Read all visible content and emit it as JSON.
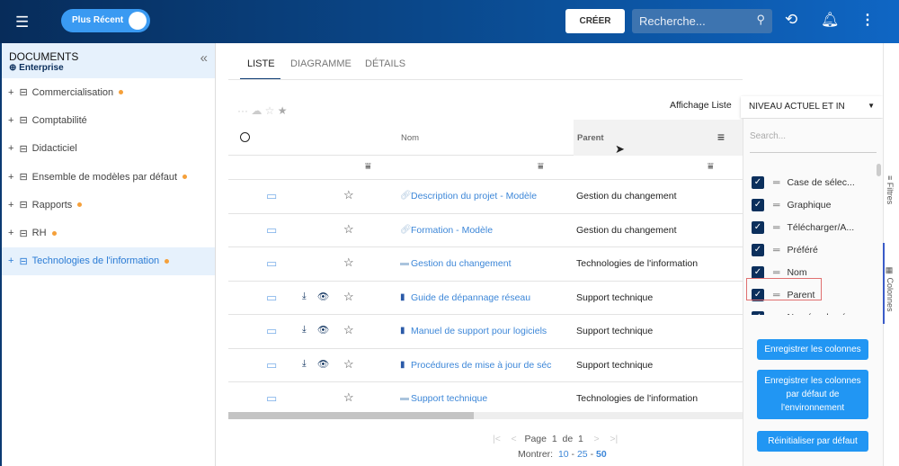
{
  "header": {
    "toggle_label": "Plus Récent",
    "create_label": "CRÉER",
    "search_placeholder": "Recherche..."
  },
  "sidebar": {
    "title": "DOCUMENTS",
    "subtitle": "Enterprise",
    "items": [
      {
        "label": "Commercialisation",
        "dot": true
      },
      {
        "label": "Comptabilité",
        "dot": false
      },
      {
        "label": "Didacticiel",
        "dot": false
      },
      {
        "label": "Ensemble de modèles par défaut",
        "dot": true
      },
      {
        "label": "Rapports",
        "dot": true
      },
      {
        "label": "RH",
        "dot": true
      },
      {
        "label": "Technologies de l'information",
        "dot": true,
        "selected": true
      }
    ]
  },
  "tabs": [
    "LISTE",
    "DIAGRAMME",
    "DÉTAILS"
  ],
  "view": {
    "label": "Affichage Liste",
    "value": "NIVEAU ACTUEL ET IN"
  },
  "table": {
    "headers": {
      "name": "Nom",
      "parent": "Parent"
    },
    "rows": [
      {
        "type": "link",
        "name": "Description du projet - Modèle",
        "parent": "Gestion du changement",
        "actions": false
      },
      {
        "type": "link",
        "name": "Formation - Modèle",
        "parent": "Gestion du changement",
        "actions": false
      },
      {
        "type": "folder",
        "name": "Gestion du changement",
        "parent": "Technologies de l'information",
        "actions": false
      },
      {
        "type": "word",
        "name": "Guide de dépannage réseau",
        "parent": "Support technique",
        "actions": true
      },
      {
        "type": "word",
        "name": "Manuel de support pour logiciels",
        "parent": "Support technique",
        "actions": true
      },
      {
        "type": "word",
        "name": "Procédures de mise à jour de séc",
        "parent": "Support technique",
        "actions": true
      },
      {
        "type": "folder",
        "name": "Support technique",
        "parent": "Technologies de l'information",
        "actions": false
      }
    ]
  },
  "pagination": {
    "page_label": "Page",
    "page": "1",
    "of_label": "de",
    "total": "1",
    "show_label": "Montrer:",
    "sizes": [
      "10",
      "25",
      "50"
    ]
  },
  "columns_panel": {
    "search_placeholder": "Search...",
    "items": [
      "Case de sélec...",
      "Graphique",
      "Télécharger/A...",
      "Préféré",
      "Nom",
      "Parent",
      "Numéro de sér..."
    ],
    "save": "Enregistrer les colonnes",
    "save_default": "Enregistrer les colonnes par défaut de l'environnement",
    "reset": "Réinitialiser par défaut"
  },
  "side_tabs": {
    "filters": "Filtres",
    "columns": "Colonnes"
  }
}
